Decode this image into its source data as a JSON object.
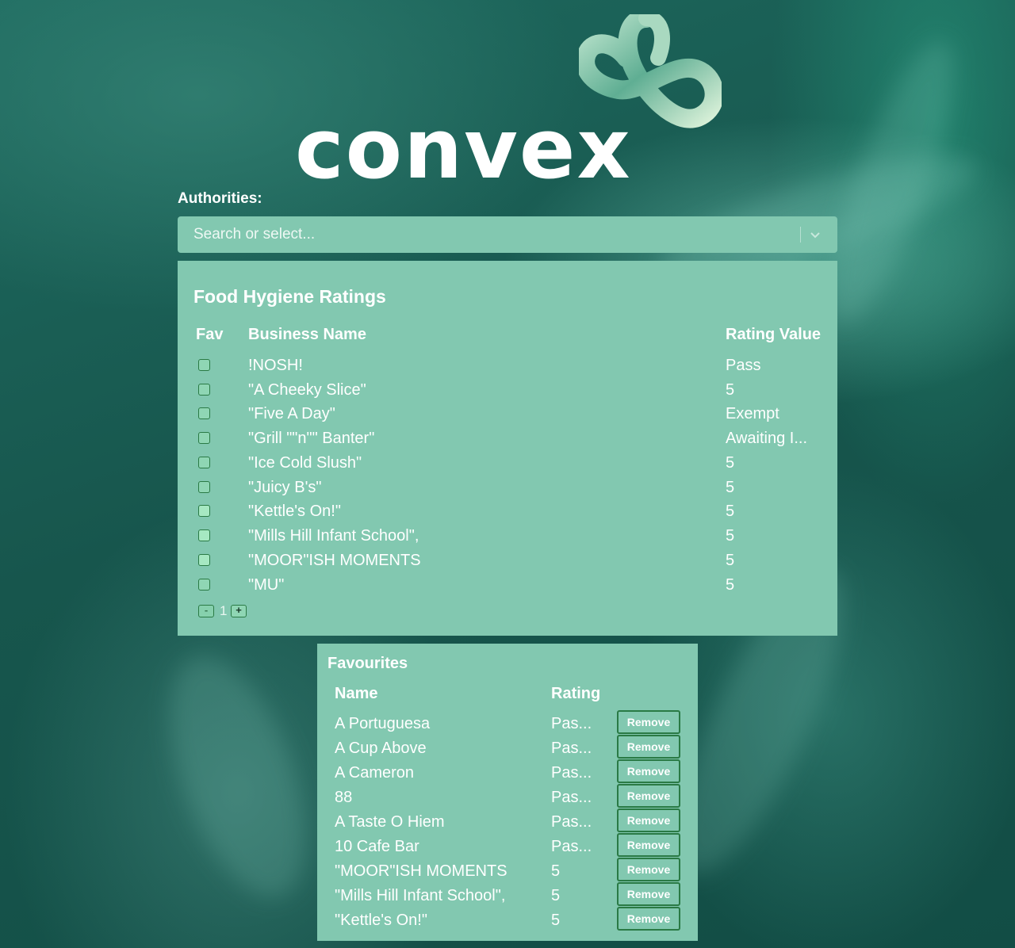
{
  "brand": {
    "logo_text": "convex"
  },
  "authorities": {
    "label": "Authorities:",
    "placeholder": "Search or select...",
    "chevron_icon": "chevron-down-icon"
  },
  "ratings": {
    "title": "Food Hygiene Ratings",
    "headers": {
      "fav": "Fav",
      "name": "Business Name",
      "rating": "Rating Value"
    },
    "rows": [
      {
        "name": "!NOSH!",
        "rating": "Pass",
        "checked": false
      },
      {
        "name": "\"A Cheeky Slice\"",
        "rating": "5",
        "checked": false
      },
      {
        "name": "\"Five A Day\"",
        "rating": "Exempt",
        "checked": false
      },
      {
        "name": "\"Grill \"\"n\"\" Banter\"",
        "rating": "Awaiting I...",
        "checked": false
      },
      {
        "name": "\"Ice Cold Slush\"",
        "rating": "5",
        "checked": false
      },
      {
        "name": "\"Juicy B's\"",
        "rating": "5",
        "checked": false
      },
      {
        "name": "\"Kettle's On!\"",
        "rating": "5",
        "checked": true
      },
      {
        "name": "\"Mills Hill Infant School\",",
        "rating": "5",
        "checked": true
      },
      {
        "name": "\"MOOR\"ISH MOMENTS",
        "rating": "5",
        "checked": true
      },
      {
        "name": "\"MU\"",
        "rating": "5",
        "checked": false
      }
    ],
    "pager": {
      "prev": "-",
      "page": "1",
      "next": "+"
    }
  },
  "favourites": {
    "title": "Favourites",
    "headers": {
      "name": "Name",
      "rating": "Rating"
    },
    "remove_label": "Remove",
    "rows": [
      {
        "name": "A Portuguesa",
        "rating": "Pas..."
      },
      {
        "name": "A Cup Above",
        "rating": "Pas..."
      },
      {
        "name": "A Cameron",
        "rating": "Pas..."
      },
      {
        "name": "88",
        "rating": "Pas..."
      },
      {
        "name": "A Taste O Hiem",
        "rating": "Pas..."
      },
      {
        "name": "10 Cafe Bar",
        "rating": "Pas..."
      },
      {
        "name": "\"MOOR\"ISH MOMENTS",
        "rating": "5"
      },
      {
        "name": "\"Mills Hill Infant School\",",
        "rating": "5"
      },
      {
        "name": "\"Kettle's On!\"",
        "rating": "5"
      }
    ]
  },
  "colors": {
    "panel": "#82c8b0",
    "background": "#17564d",
    "accent_border": "#2a7a45"
  }
}
